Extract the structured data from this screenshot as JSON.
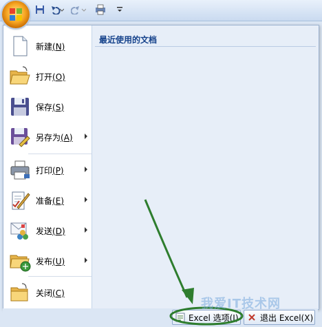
{
  "menu": {
    "recent_title": "最近使用的文档",
    "items": [
      {
        "label": "新建",
        "key": "(N)",
        "icon": "new-document-icon",
        "submenu": false
      },
      {
        "label": "打开",
        "key": "(O)",
        "icon": "open-folder-icon",
        "submenu": false
      },
      {
        "label": "保存",
        "key": "(S)",
        "icon": "save-disk-icon",
        "submenu": false
      },
      {
        "label": "另存为",
        "key": "(A)",
        "icon": "save-as-icon",
        "submenu": true
      },
      {
        "label": "打印",
        "key": "(P)",
        "icon": "printer-icon",
        "submenu": true
      },
      {
        "label": "准备",
        "key": "(E)",
        "icon": "prepare-icon",
        "submenu": true
      },
      {
        "label": "发送",
        "key": "(D)",
        "icon": "send-icon",
        "submenu": true
      },
      {
        "label": "发布",
        "key": "(U)",
        "icon": "publish-icon",
        "submenu": true
      },
      {
        "label": "关闭",
        "key": "(C)",
        "icon": "close-folder-icon",
        "submenu": false
      }
    ]
  },
  "footer": {
    "options_label": "Excel 选项(I)",
    "exit_label": "退出 Excel(X)"
  },
  "watermark": "我爱IT技术网",
  "colors": {
    "annotation_green": "#2e7d2e",
    "office_orange": "#f7a623"
  }
}
